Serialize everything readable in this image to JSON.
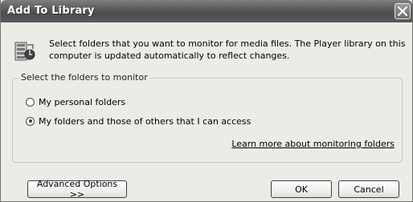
{
  "dialog": {
    "title": "Add To Library",
    "description": "Select folders that you want to monitor for media files. The Player library on this computer is updated automatically to reflect changes.",
    "icon": "media-library-icon"
  },
  "group": {
    "label": "Select the folders to monitor",
    "options": [
      {
        "label": "My personal folders",
        "checked": false
      },
      {
        "label": "My folders and those of others that I can access",
        "checked": true
      }
    ],
    "link_text": "Learn more about monitoring folders"
  },
  "buttons": {
    "advanced": "Advanced Options >>",
    "ok": "OK",
    "cancel": "Cancel"
  },
  "colors": {
    "titlebar": "#5c5c5c",
    "dialog_bg": "#ecebe6"
  }
}
